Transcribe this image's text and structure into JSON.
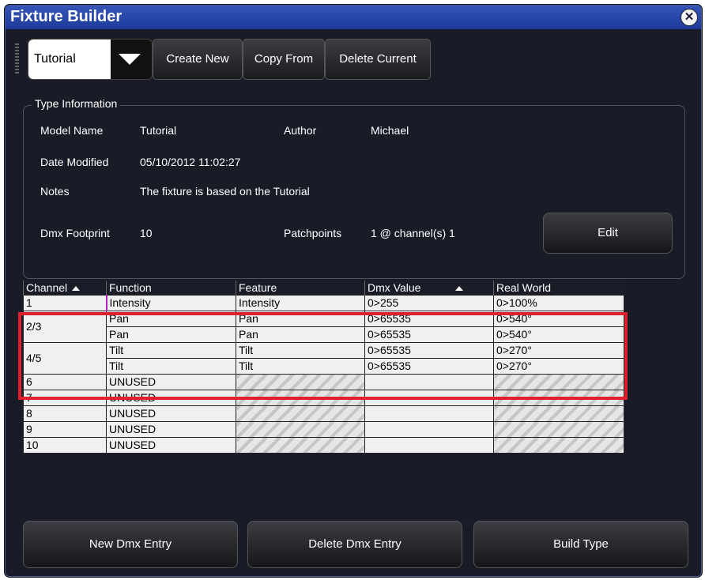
{
  "window": {
    "title": "Fixture Builder",
    "close_icon": "close-circle-icon"
  },
  "toolbar": {
    "type_select": {
      "value": "Tutorial",
      "arrow_icon": "chevron-down-icon"
    },
    "create_new": "Create New",
    "copy_from": "Copy From",
    "delete_current": "Delete Current"
  },
  "type_info": {
    "legend": "Type Information",
    "model_name_label": "Model Name",
    "model_name": "Tutorial",
    "author_label": "Author",
    "author": "Michael",
    "date_modified_label": "Date Modified",
    "date_modified": "05/10/2012 11:02:27",
    "notes_label": "Notes",
    "notes": "The fixture is based on the Tutorial",
    "dmx_footprint_label": "Dmx Footprint",
    "dmx_footprint": "10",
    "patchpoints_label": "Patchpoints",
    "patchpoints": "1 @ channel(s)  1",
    "edit": "Edit"
  },
  "table": {
    "columns": [
      "Channel",
      "Function",
      "Feature",
      "Dmx Value",
      "Real World"
    ],
    "rows": [
      {
        "channel": "1",
        "function": "Intensity",
        "feature": "Intensity",
        "dmx_value": "0>255",
        "real_world": "0>100%"
      },
      {
        "channel": "2/3",
        "function": "Pan",
        "feature": "Pan",
        "dmx_value": "0>65535",
        "real_world": "0>540°"
      },
      {
        "channel": "",
        "function": "Pan",
        "feature": "Pan",
        "dmx_value": "0>65535",
        "real_world": "0>540°"
      },
      {
        "channel": "4/5",
        "function": "Tilt",
        "feature": "Tilt",
        "dmx_value": "0>65535",
        "real_world": "0>270°"
      },
      {
        "channel": "",
        "function": "Tilt",
        "feature": "Tilt",
        "dmx_value": "0>65535",
        "real_world": "0>270°"
      },
      {
        "channel": "6",
        "function": "UNUSED",
        "feature": "",
        "dmx_value": "",
        "real_world": ""
      },
      {
        "channel": "7",
        "function": "UNUSED",
        "feature": "",
        "dmx_value": "",
        "real_world": ""
      },
      {
        "channel": "8",
        "function": "UNUSED",
        "feature": "",
        "dmx_value": "",
        "real_world": ""
      },
      {
        "channel": "9",
        "function": "UNUSED",
        "feature": "",
        "dmx_value": "",
        "real_world": ""
      },
      {
        "channel": "10",
        "function": "UNUSED",
        "feature": "",
        "dmx_value": "",
        "real_world": ""
      }
    ]
  },
  "bottom": {
    "new_dmx_entry": "New Dmx Entry",
    "delete_dmx_entry": "Delete Dmx Entry",
    "build_type": "Build Type"
  },
  "colors": {
    "title_bar": "#2a4cb0",
    "background": "#191c27",
    "highlight": "#e0202c"
  }
}
